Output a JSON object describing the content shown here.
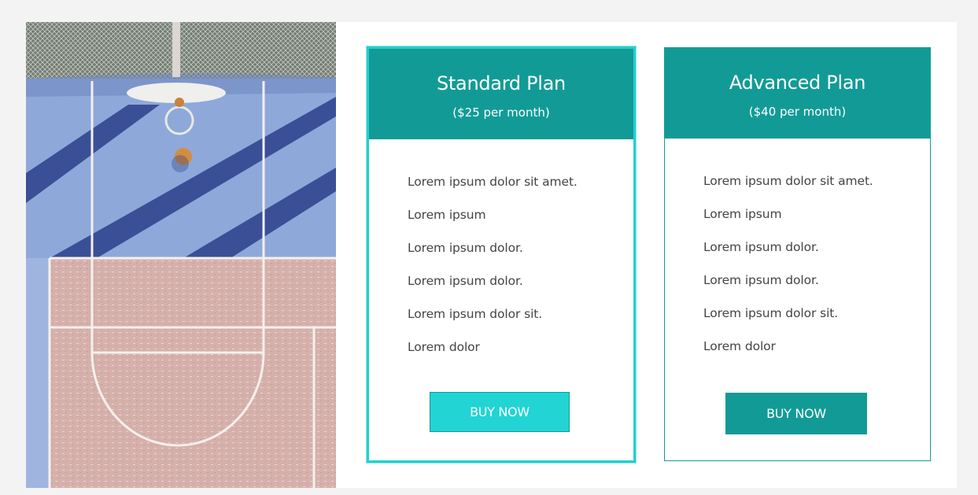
{
  "plans": [
    {
      "name": "Standard Plan",
      "price": "($25 per month)",
      "features": [
        "Lorem ipsum dolor sit amet.",
        "Lorem ipsum",
        "Lorem ipsum dolor.",
        "Lorem ipsum dolor.",
        "Lorem ipsum dolor sit.",
        "Lorem dolor"
      ],
      "button_label": "BUY NOW"
    },
    {
      "name": "Advanced Plan",
      "price": "($40 per month)",
      "features": [
        "Lorem ipsum dolor sit amet.",
        "Lorem ipsum",
        "Lorem ipsum dolor.",
        "Lorem ipsum dolor.",
        "Lorem ipsum dolor sit.",
        "Lorem dolor"
      ],
      "button_label": "BUY NOW"
    }
  ],
  "colors": {
    "teal": "#129b96",
    "bright_teal": "#22d4d4",
    "court_blue": "#8da8d8",
    "court_clay": "#d3aaa5"
  }
}
